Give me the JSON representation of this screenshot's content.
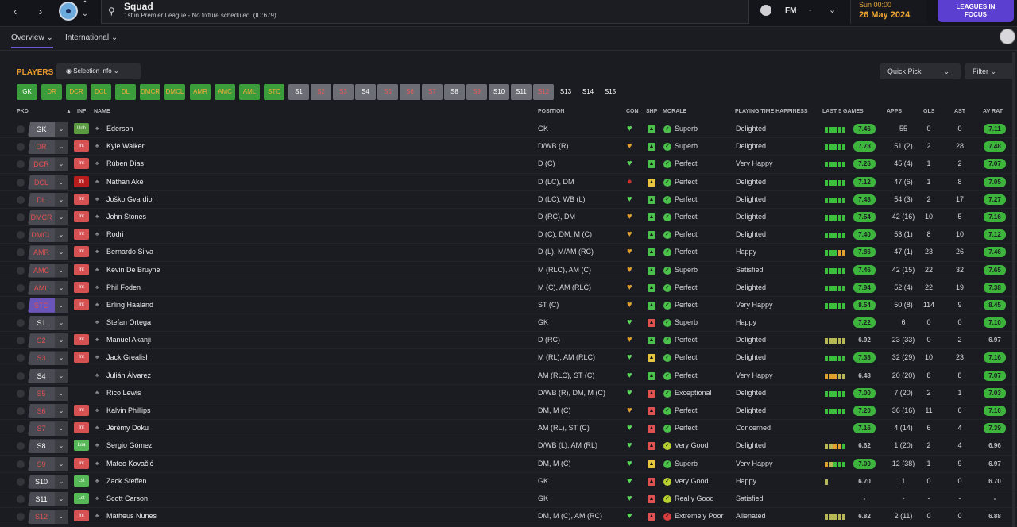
{
  "nav": {
    "back": "‹",
    "forward": "›",
    "up": "⌃",
    "down": "⌄"
  },
  "search": {
    "title": "Squad",
    "subtitle": "1st in Premier League - No fixture scheduled. (ID:679)"
  },
  "header": {
    "fm": "FM",
    "dash": "-",
    "time": "Sun 00:00",
    "date": "26 May 2024",
    "focus_line1": "LEAGUES IN",
    "focus_line2": "FOCUS"
  },
  "tabs": [
    {
      "label": "Overview"
    },
    {
      "label": "International"
    }
  ],
  "toolbar": {
    "players": "PLAYERS",
    "selection_info": "Selection Info",
    "quick_pick": "Quick Pick",
    "filter": "Filter"
  },
  "position_pills": [
    "GK",
    "DR",
    "DCR",
    "DCL",
    "DL",
    "DMCR",
    "DMCL",
    "AMR",
    "AMC",
    "AML",
    "STC",
    "S1",
    "S2",
    "S3",
    "S4",
    "S5",
    "S6",
    "S7",
    "S8",
    "S9",
    "S10",
    "S11",
    "S12",
    "S13",
    "S14",
    "S15"
  ],
  "columns": {
    "pkd": "PKD",
    "inf": "INF",
    "name": "NAME",
    "position": "POSITION",
    "con": "CON",
    "shp": "SHP",
    "morale": "MORALE",
    "pth": "PLAYING TIME HAPPINESS",
    "last5": "LAST 5 GAMES",
    "apps": "APPS",
    "gls": "GLS",
    "ast": "AST",
    "avrat": "AV RAT"
  },
  "players": [
    {
      "pkd": "GK",
      "inf": "Unh",
      "name": "Ederson",
      "position": "GK",
      "morale": "Superb",
      "pth": "Delighted",
      "last5": "7.46",
      "apps": "55",
      "gls": "0",
      "ast": "0",
      "avrat": "7.11"
    },
    {
      "pkd": "DR",
      "inf": "Int",
      "name": "Kyle Walker",
      "position": "D/WB (R)",
      "morale": "Superb",
      "pth": "Delighted",
      "last5": "7.78",
      "apps": "51 (2)",
      "gls": "2",
      "ast": "28",
      "avrat": "7.48"
    },
    {
      "pkd": "DCR",
      "inf": "Int",
      "name": "Rúben Dias",
      "position": "D (C)",
      "morale": "Perfect",
      "pth": "Very Happy",
      "last5": "7.26",
      "apps": "45 (4)",
      "gls": "1",
      "ast": "2",
      "avrat": "7.07"
    },
    {
      "pkd": "DCL",
      "inf": "Inj",
      "name": "Nathan Aké",
      "position": "D (LC), DM",
      "morale": "Perfect",
      "pth": "Delighted",
      "last5": "7.12",
      "apps": "47 (6)",
      "gls": "1",
      "ast": "8",
      "avrat": "7.05"
    },
    {
      "pkd": "DL",
      "inf": "Int",
      "name": "Joško Gvardiol",
      "position": "D (LC), WB (L)",
      "morale": "Perfect",
      "pth": "Delighted",
      "last5": "7.48",
      "apps": "54 (3)",
      "gls": "2",
      "ast": "17",
      "avrat": "7.27"
    },
    {
      "pkd": "DMCR",
      "inf": "Int",
      "name": "John Stones",
      "position": "D (RC), DM",
      "morale": "Perfect",
      "pth": "Delighted",
      "last5": "7.54",
      "apps": "42 (16)",
      "gls": "10",
      "ast": "5",
      "avrat": "7.16"
    },
    {
      "pkd": "DMCL",
      "inf": "Int",
      "name": "Rodri",
      "position": "D (C), DM, M (C)",
      "morale": "Perfect",
      "pth": "Delighted",
      "last5": "7.40",
      "apps": "53 (1)",
      "gls": "8",
      "ast": "10",
      "avrat": "7.12"
    },
    {
      "pkd": "AMR",
      "inf": "Int",
      "name": "Bernardo Silva",
      "position": "D (L), M/AM (RC)",
      "morale": "Perfect",
      "pth": "Happy",
      "last5": "7.86",
      "apps": "47 (1)",
      "gls": "23",
      "ast": "26",
      "avrat": "7.46"
    },
    {
      "pkd": "AMC",
      "inf": "Int",
      "name": "Kevin De Bruyne",
      "position": "M (RLC), AM (C)",
      "morale": "Superb",
      "pth": "Satisfied",
      "last5": "7.46",
      "apps": "42 (15)",
      "gls": "22",
      "ast": "32",
      "avrat": "7.65"
    },
    {
      "pkd": "AML",
      "inf": "Int",
      "name": "Phil Foden",
      "position": "M (C), AM (RLC)",
      "morale": "Perfect",
      "pth": "Delighted",
      "last5": "7.94",
      "apps": "52 (4)",
      "gls": "22",
      "ast": "19",
      "avrat": "7.38"
    },
    {
      "pkd": "STC",
      "inf": "Int",
      "name": "Erling Haaland",
      "position": "ST (C)",
      "morale": "Perfect",
      "pth": "Very Happy",
      "last5": "8.54",
      "apps": "50 (8)",
      "gls": "114",
      "ast": "9",
      "avrat": "8.45"
    },
    {
      "pkd": "S1",
      "inf": "",
      "name": "Stefan Ortega",
      "position": "GK",
      "morale": "Superb",
      "pth": "Happy",
      "last5": "7.22",
      "apps": "6",
      "gls": "0",
      "ast": "0",
      "avrat": "7.10"
    },
    {
      "pkd": "S2",
      "inf": "Int",
      "name": "Manuel Akanji",
      "position": "D (RC)",
      "morale": "Perfect",
      "pth": "Delighted",
      "last5": "6.92",
      "apps": "23 (33)",
      "gls": "0",
      "ast": "2",
      "avrat": "6.97"
    },
    {
      "pkd": "S3",
      "inf": "Int",
      "name": "Jack Grealish",
      "position": "M (RL), AM (RLC)",
      "morale": "Perfect",
      "pth": "Delighted",
      "last5": "7.38",
      "apps": "32 (29)",
      "gls": "10",
      "ast": "23",
      "avrat": "7.16"
    },
    {
      "pkd": "S4",
      "inf": "",
      "name": "Julián Álvarez",
      "position": "AM (RLC), ST (C)",
      "morale": "Perfect",
      "pth": "Very Happy",
      "last5": "6.48",
      "apps": "20 (20)",
      "gls": "8",
      "ast": "8",
      "avrat": "7.07"
    },
    {
      "pkd": "S5",
      "inf": "",
      "name": "Rico Lewis",
      "position": "D/WB (R), DM, M (C)",
      "morale": "Exceptional",
      "pth": "Delighted",
      "last5": "7.00",
      "apps": "7 (20)",
      "gls": "2",
      "ast": "1",
      "avrat": "7.03"
    },
    {
      "pkd": "S6",
      "inf": "Int",
      "name": "Kalvin Phillips",
      "position": "DM, M (C)",
      "morale": "Perfect",
      "pth": "Delighted",
      "last5": "7.20",
      "apps": "36 (16)",
      "gls": "11",
      "ast": "6",
      "avrat": "7.10"
    },
    {
      "pkd": "S7",
      "inf": "Int",
      "name": "Jérémy Doku",
      "position": "AM (RL), ST (C)",
      "morale": "Perfect",
      "pth": "Concerned",
      "last5": "7.16",
      "apps": "4 (14)",
      "gls": "6",
      "ast": "4",
      "avrat": "7.39"
    },
    {
      "pkd": "S8",
      "inf": "Loa",
      "name": "Sergio Gómez",
      "position": "D/WB (L), AM (RL)",
      "morale": "Very Good",
      "pth": "Delighted",
      "last5": "6.62",
      "apps": "1 (20)",
      "gls": "2",
      "ast": "4",
      "avrat": "6.96"
    },
    {
      "pkd": "S9",
      "inf": "Int",
      "name": "Mateo Kovačić",
      "position": "DM, M (C)",
      "morale": "Superb",
      "pth": "Very Happy",
      "last5": "7.00",
      "apps": "12 (38)",
      "gls": "1",
      "ast": "9",
      "avrat": "6.97"
    },
    {
      "pkd": "S10",
      "inf": "Lst",
      "name": "Zack Steffen",
      "position": "GK",
      "morale": "Very Good",
      "pth": "Happy",
      "last5": "6.70",
      "apps": "1",
      "gls": "0",
      "ast": "0",
      "avrat": "6.70"
    },
    {
      "pkd": "S11",
      "inf": "Lst",
      "name": "Scott Carson",
      "position": "GK",
      "morale": "Really Good",
      "pth": "Satisfied",
      "last5": "-",
      "apps": "-",
      "gls": "-",
      "ast": "-",
      "avrat": "-"
    },
    {
      "pkd": "S12",
      "inf": "Int",
      "name": "Matheus Nunes",
      "position": "DM, M (C), AM (RC)",
      "morale": "Extremely Poor",
      "pth": "Alienated",
      "last5": "6.82",
      "apps": "2 (11)",
      "gls": "0",
      "ast": "0",
      "avrat": "6.88"
    }
  ]
}
